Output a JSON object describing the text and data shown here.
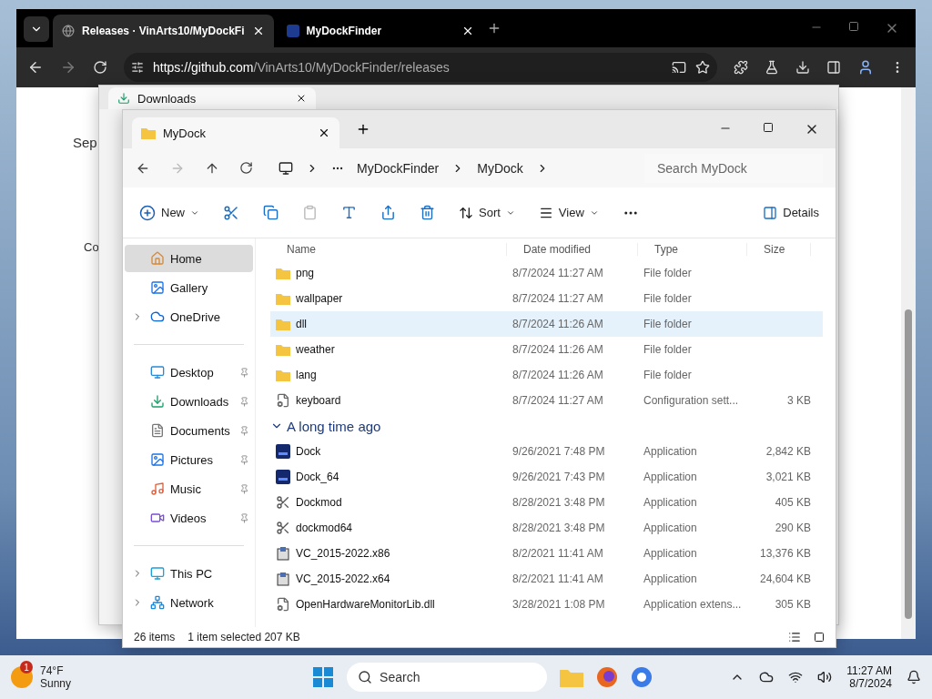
{
  "browser": {
    "tabs": [
      {
        "title": "Releases · VinArts10/MyDockFi",
        "kind": "globe",
        "selected": true
      },
      {
        "title": "MyDockFinder",
        "kind": "app",
        "selected": false
      }
    ],
    "url_host": "https://github.com",
    "url_path": "/VinArts10/MyDockFinder/releases",
    "page_fragments": [
      "Sep",
      "Co"
    ]
  },
  "downloads_window": {
    "title": "Downloads"
  },
  "explorer": {
    "title": "MyDock",
    "breadcrumb": [
      "MyDockFinder",
      "MyDock"
    ],
    "search": {
      "placeholder": "Search MyDock"
    },
    "toolbar": {
      "new_label": "New",
      "sort_label": "Sort",
      "view_label": "View",
      "details_label": "Details"
    },
    "sidebar": [
      [
        {
          "label": "Home",
          "kind": "home",
          "expandable": false,
          "pinned": false,
          "selected": true
        },
        {
          "label": "Gallery",
          "kind": "gallery",
          "expandable": false,
          "pinned": false,
          "selected": false
        },
        {
          "label": "OneDrive",
          "kind": "cloud",
          "expandable": true,
          "pinned": false,
          "selected": false
        }
      ],
      [
        {
          "label": "Desktop",
          "kind": "desktop",
          "expandable": false,
          "pinned": true,
          "selected": false
        },
        {
          "label": "Downloads",
          "kind": "download",
          "expandable": false,
          "pinned": true,
          "selected": false
        },
        {
          "label": "Documents",
          "kind": "document",
          "expandable": false,
          "pinned": true,
          "selected": false
        },
        {
          "label": "Pictures",
          "kind": "gallery",
          "expandable": false,
          "pinned": true,
          "selected": false
        },
        {
          "label": "Music",
          "kind": "music",
          "expandable": false,
          "pinned": true,
          "selected": false
        },
        {
          "label": "Videos",
          "kind": "video",
          "expandable": false,
          "pinned": true,
          "selected": false
        }
      ],
      [
        {
          "label": "This PC",
          "kind": "pc",
          "expandable": true,
          "pinned": false,
          "selected": false
        },
        {
          "label": "Network",
          "kind": "network",
          "expandable": true,
          "pinned": false,
          "selected": false
        }
      ]
    ],
    "columns": [
      "Name",
      "Date modified",
      "Type",
      "Size"
    ],
    "groups": [
      {
        "rows": [
          {
            "name": "png",
            "date": "8/7/2024 11:27 AM",
            "type": "File folder",
            "kind": "folder",
            "selected": false
          },
          {
            "name": "wallpaper",
            "date": "8/7/2024 11:27 AM",
            "type": "File folder",
            "kind": "folder",
            "selected": false
          },
          {
            "name": "dll",
            "date": "8/7/2024 11:26 AM",
            "type": "File folder",
            "kind": "folder",
            "selected": true
          },
          {
            "name": "weather",
            "date": "8/7/2024 11:26 AM",
            "type": "File folder",
            "kind": "folder",
            "selected": false
          },
          {
            "name": "lang",
            "date": "8/7/2024 11:26 AM",
            "type": "File folder",
            "kind": "folder",
            "selected": false
          },
          {
            "name": "keyboard",
            "date": "8/7/2024 11:27 AM",
            "type": "Configuration sett...",
            "size": "3 KB",
            "kind": "config",
            "selected": false
          }
        ]
      },
      {
        "title": "A long time ago",
        "expanded": true,
        "rows": [
          {
            "name": "Dock",
            "date": "9/26/2021 7:48 PM",
            "type": "Application",
            "size": "2,842 KB",
            "kind": "dock",
            "selected": false
          },
          {
            "name": "Dock_64",
            "date": "9/26/2021 7:43 PM",
            "type": "Application",
            "size": "3,021 KB",
            "kind": "dock",
            "selected": false
          },
          {
            "name": "Dockmod",
            "date": "8/28/2021 3:48 PM",
            "type": "Application",
            "size": "405 KB",
            "kind": "tool",
            "selected": false
          },
          {
            "name": "dockmod64",
            "date": "8/28/2021 3:48 PM",
            "type": "Application",
            "size": "290 KB",
            "kind": "tool",
            "selected": false
          },
          {
            "name": "VC_2015-2022.x86",
            "date": "8/2/2021 11:41 AM",
            "type": "Application",
            "size": "13,376 KB",
            "kind": "installer",
            "selected": false
          },
          {
            "name": "VC_2015-2022.x64",
            "date": "8/2/2021 11:41 AM",
            "type": "Application",
            "size": "24,604 KB",
            "kind": "installer",
            "selected": false
          },
          {
            "name": "OpenHardwareMonitorLib.dll",
            "date": "3/28/2021 1:08 PM",
            "type": "Application extens...",
            "size": "305 KB",
            "kind": "config",
            "selected": false
          }
        ]
      }
    ],
    "status": {
      "count": "26 items",
      "selection": "1 item selected",
      "size": "207 KB"
    }
  },
  "taskbar": {
    "weather_badge": "1",
    "temperature": "74°F",
    "condition": "Sunny",
    "search_placeholder": "Search",
    "time": "11:27 AM",
    "date": "8/7/2024"
  }
}
